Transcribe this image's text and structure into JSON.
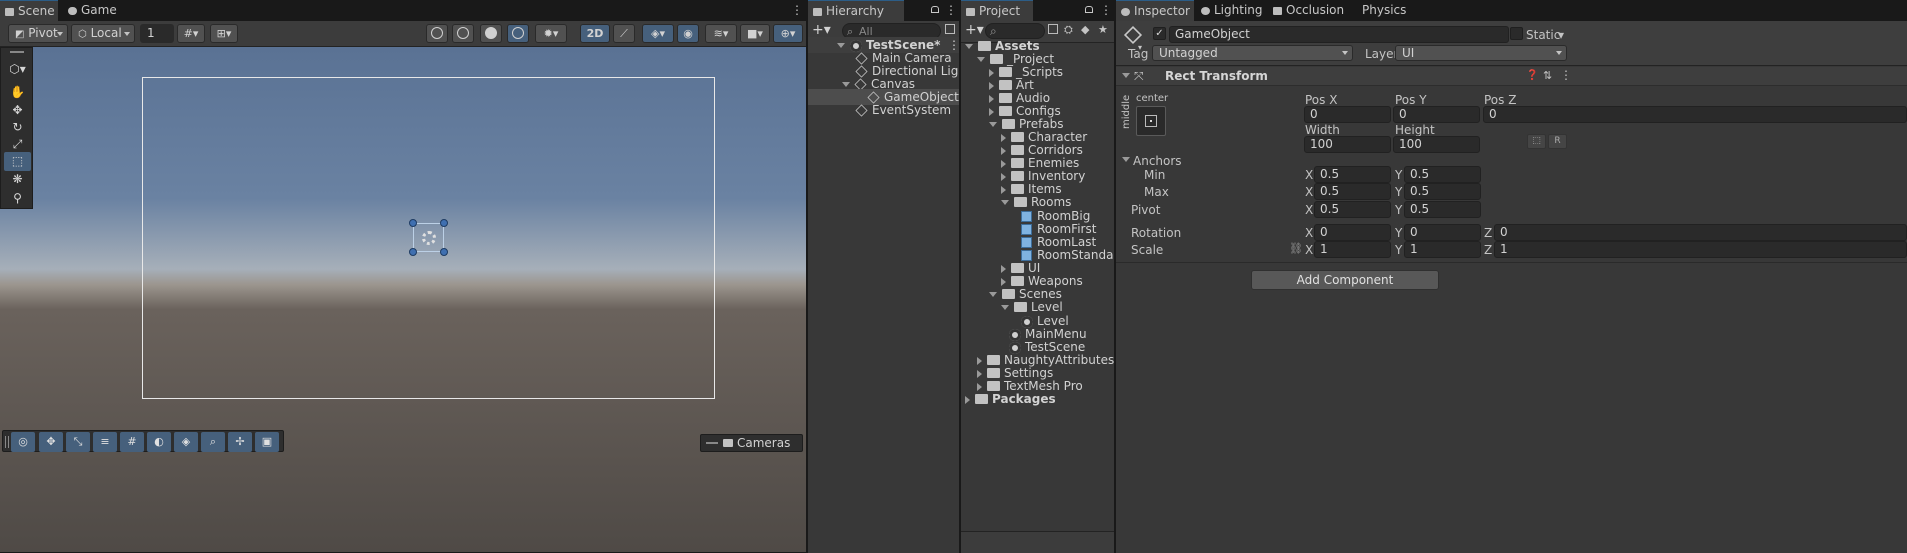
{
  "scene_tabs": {
    "scene": "Scene",
    "game": "Game"
  },
  "scene_toolbar": {
    "pivot": "Pivot",
    "local": "Local",
    "grid_value": "1",
    "mode_2d": "2D"
  },
  "scene_view": {
    "cameras_label": "Cameras"
  },
  "hierarchy": {
    "tab": "Hierarchy",
    "search_placeholder": "All",
    "scene": "TestScene*",
    "items": [
      "Main Camera",
      "Directional Light",
      "Canvas",
      "GameObject",
      "EventSystem"
    ],
    "selected": "GameObject"
  },
  "project": {
    "tab": "Project",
    "assets_label": "Assets",
    "items": [
      "_Project",
      "_Scripts",
      "Art",
      "Audio",
      "Configs",
      "Prefabs",
      "Character",
      "Corridors",
      "Enemies",
      "Inventory",
      "Items",
      "Rooms",
      "RoomBig",
      "RoomFirst",
      "RoomLast",
      "RoomStandart",
      "UI",
      "Weapons",
      "Scenes",
      "Level",
      "Level",
      "MainMenu",
      "TestScene",
      "NaughtyAttributes",
      "Settings",
      "TextMesh Pro",
      "Packages"
    ]
  },
  "inspector": {
    "tabs": [
      "Inspector",
      "Lighting",
      "Occlusion",
      "Physics Debugger"
    ],
    "object_name": "GameObject",
    "active": true,
    "static_label": "Static",
    "tag_label": "Tag",
    "tag_value": "Untagged",
    "layer_label": "Layer",
    "layer_value": "UI",
    "component_title": "Rect Transform",
    "anchor_h": "center",
    "anchor_v": "middle",
    "pos_labels": [
      "Pos X",
      "Pos Y",
      "Pos Z"
    ],
    "pos_values": [
      "0",
      "0",
      "0"
    ],
    "size_labels": [
      "Width",
      "Height"
    ],
    "size_values": [
      "100",
      "100"
    ],
    "raw_button": "R",
    "anchors_label": "Anchors",
    "min_label": "Min",
    "max_label": "Max",
    "min": [
      "0.5",
      "0.5"
    ],
    "max": [
      "0.5",
      "0.5"
    ],
    "pivot_label": "Pivot",
    "pivot": [
      "0.5",
      "0.5"
    ],
    "rotation_label": "Rotation",
    "rotation": [
      "0",
      "0",
      "0"
    ],
    "scale_label": "Scale",
    "scale": [
      "1",
      "1",
      "1"
    ],
    "axis": [
      "X",
      "Y",
      "Z"
    ],
    "add_component": "Add Component"
  },
  "colors": {
    "accent": "#46607c",
    "selection": "#4d4d4d",
    "sky_top": "#5a7294",
    "ground": "#4f4a46"
  }
}
